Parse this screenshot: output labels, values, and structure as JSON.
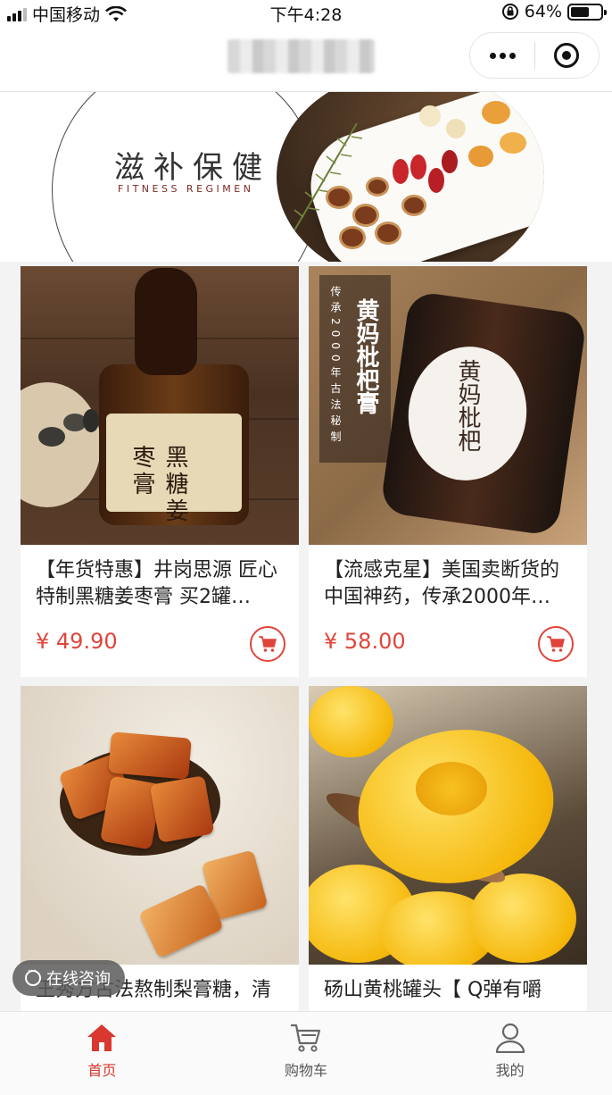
{
  "status_bar": {
    "carrier": "中国移动",
    "time": "下午4:28",
    "battery": "64%",
    "battery_level": 0.64
  },
  "nav": {
    "title_blurred": true,
    "icons": [
      "more-icon",
      "close-mini-program-icon"
    ]
  },
  "banner": {
    "title": "滋补保健",
    "subtitle": "FITNESS REGIMEN"
  },
  "products": [
    {
      "title": "【年货特惠】井岗思源 匠心特制黑糖姜枣膏 买2罐…",
      "price": "¥ 49.90",
      "image_text": "黑糖姜枣膏"
    },
    {
      "title": "【流感克星】美国卖断货的中国神药，传承2000年…",
      "price": "¥ 58.00",
      "image_text_main": "黄妈枇杷膏",
      "image_text_side": "传承2000年古法秘制",
      "jar_text": "黄妈枇杷"
    },
    {
      "title": "王秀方古法熬制梨膏糖，清",
      "price": ""
    },
    {
      "title": "砀山黄桃罐头【 Q弹有嚼",
      "price": ""
    }
  ],
  "chat_button": {
    "label": "在线咨询"
  },
  "tabs": [
    {
      "label": "首页",
      "icon": "home-icon",
      "active": true
    },
    {
      "label": "购物车",
      "icon": "cart-icon",
      "active": false
    },
    {
      "label": "我的",
      "icon": "user-icon",
      "active": false
    }
  ],
  "colors": {
    "accent": "#e0453a",
    "tab_active": "#d9382e"
  }
}
